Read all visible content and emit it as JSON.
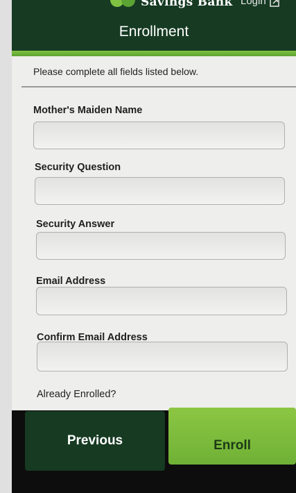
{
  "header": {
    "brand_name": "Savings Bank",
    "login_label": "Login",
    "title": "Enrollment"
  },
  "form": {
    "instructions": "Please complete all fields listed below.",
    "fields": [
      {
        "label": "Mother's Maiden Name",
        "value": ""
      },
      {
        "label": "Security Question",
        "value": ""
      },
      {
        "label": "Security Answer",
        "value": ""
      },
      {
        "label": "Email Address",
        "value": ""
      },
      {
        "label": "Confirm Email Address",
        "value": ""
      }
    ],
    "already_enrolled_label": "Already Enrolled?"
  },
  "actions": {
    "previous_label": "Previous",
    "enroll_label": "Enroll"
  },
  "colors": {
    "header_bg": "#163a22",
    "accent_green": "#7fc241",
    "form_bg": "#eeeeec"
  },
  "icons": {
    "logo": "bank-logo-icon",
    "login": "login-arrow-icon"
  }
}
